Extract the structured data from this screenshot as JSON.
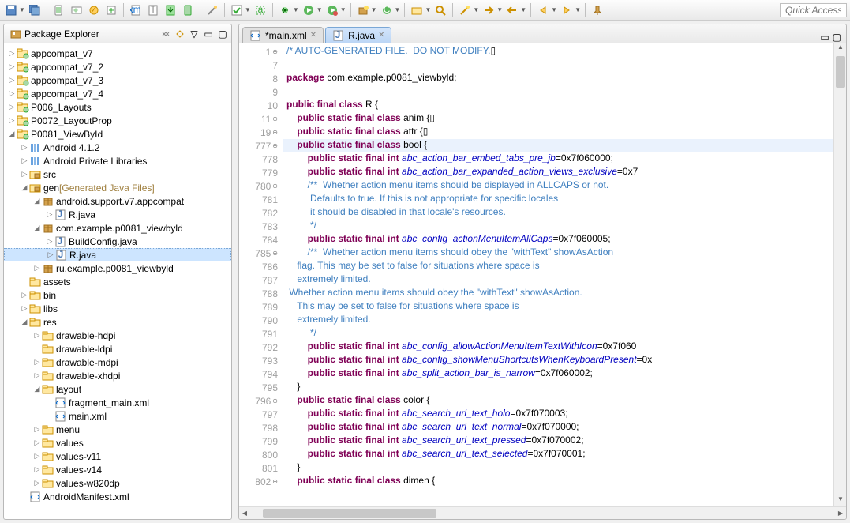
{
  "quick_access_placeholder": "Quick Access",
  "pkg_explorer_title": "Package Explorer",
  "tree": [
    {
      "d": 0,
      "t": "▷",
      "i": "prj",
      "l": "appcompat_v7"
    },
    {
      "d": 0,
      "t": "▷",
      "i": "prj",
      "l": "appcompat_v7_2"
    },
    {
      "d": 0,
      "t": "▷",
      "i": "prj",
      "l": "appcompat_v7_3"
    },
    {
      "d": 0,
      "t": "▷",
      "i": "prj",
      "l": "appcompat_v7_4"
    },
    {
      "d": 0,
      "t": "▷",
      "i": "prj",
      "l": "P006_Layouts"
    },
    {
      "d": 0,
      "t": "▷",
      "i": "prj",
      "l": "P0072_LayoutProp"
    },
    {
      "d": 0,
      "t": "◢",
      "i": "prj",
      "l": "P0081_ViewById"
    },
    {
      "d": 1,
      "t": "▷",
      "i": "lib",
      "l": "Android 4.1.2"
    },
    {
      "d": 1,
      "t": "▷",
      "i": "lib",
      "l": "Android Private Libraries"
    },
    {
      "d": 1,
      "t": "▷",
      "i": "pkgf",
      "l": "src"
    },
    {
      "d": 1,
      "t": "◢",
      "i": "pkgf",
      "l": "gen",
      "decor": " [Generated Java Files]"
    },
    {
      "d": 2,
      "t": "◢",
      "i": "pkg",
      "l": "android.support.v7.appcompat"
    },
    {
      "d": 3,
      "t": "▷",
      "i": "java",
      "l": "R.java"
    },
    {
      "d": 2,
      "t": "◢",
      "i": "pkg",
      "l": "com.example.p0081_viewbyld"
    },
    {
      "d": 3,
      "t": "▷",
      "i": "java",
      "l": "BuildConfig.java"
    },
    {
      "d": 3,
      "t": "▷",
      "i": "java",
      "l": "R.java",
      "sel": true
    },
    {
      "d": 2,
      "t": "▷",
      "i": "pkg",
      "l": "ru.example.p0081_viewbyld"
    },
    {
      "d": 1,
      "t": " ",
      "i": "fld",
      "l": "assets"
    },
    {
      "d": 1,
      "t": "▷",
      "i": "fld",
      "l": "bin"
    },
    {
      "d": 1,
      "t": "▷",
      "i": "fld",
      "l": "libs"
    },
    {
      "d": 1,
      "t": "◢",
      "i": "fld",
      "l": "res"
    },
    {
      "d": 2,
      "t": "▷",
      "i": "fld",
      "l": "drawable-hdpi"
    },
    {
      "d": 2,
      "t": " ",
      "i": "fld",
      "l": "drawable-ldpi"
    },
    {
      "d": 2,
      "t": "▷",
      "i": "fld",
      "l": "drawable-mdpi"
    },
    {
      "d": 2,
      "t": "▷",
      "i": "fld",
      "l": "drawable-xhdpi"
    },
    {
      "d": 2,
      "t": "◢",
      "i": "fld",
      "l": "layout"
    },
    {
      "d": 3,
      "t": " ",
      "i": "xml",
      "l": "fragment_main.xml"
    },
    {
      "d": 3,
      "t": " ",
      "i": "xml",
      "l": "main.xml"
    },
    {
      "d": 2,
      "t": "▷",
      "i": "fld",
      "l": "menu"
    },
    {
      "d": 2,
      "t": "▷",
      "i": "fld",
      "l": "values"
    },
    {
      "d": 2,
      "t": "▷",
      "i": "fld",
      "l": "values-v11"
    },
    {
      "d": 2,
      "t": "▷",
      "i": "fld",
      "l": "values-v14"
    },
    {
      "d": 2,
      "t": "▷",
      "i": "fld",
      "l": "values-w820dp"
    },
    {
      "d": 1,
      "t": " ",
      "i": "xml",
      "l": "AndroidManifest.xml"
    }
  ],
  "tabs": [
    {
      "label": "*main.xml",
      "icon": "xml",
      "active": false
    },
    {
      "label": "R.java",
      "icon": "java",
      "active": true
    }
  ],
  "code": {
    "lines": [
      {
        "n": "1",
        "fold": "⊕",
        "segs": [
          {
            "c": "com",
            "t": "/* AUTO-GENERATED FILE.  DO NOT MODIFY."
          },
          {
            "c": "pln",
            "t": "▯"
          }
        ]
      },
      {
        "n": "7",
        "segs": []
      },
      {
        "n": "8",
        "segs": [
          {
            "c": "kw",
            "t": "package"
          },
          {
            "c": "pln",
            "t": " com.example.p0081_viewbyld;"
          }
        ]
      },
      {
        "n": "9",
        "segs": []
      },
      {
        "n": "10",
        "segs": [
          {
            "c": "kw",
            "t": "public final class"
          },
          {
            "c": "pln",
            "t": " R {"
          }
        ]
      },
      {
        "n": "11",
        "fold": "⊕",
        "segs": [
          {
            "c": "pln",
            "t": "    "
          },
          {
            "c": "kw",
            "t": "public static final class"
          },
          {
            "c": "pln",
            "t": " anim {▯"
          }
        ]
      },
      {
        "n": "19",
        "fold": "⊕",
        "segs": [
          {
            "c": "pln",
            "t": "    "
          },
          {
            "c": "kw",
            "t": "public static final class"
          },
          {
            "c": "pln",
            "t": " attr {▯"
          }
        ]
      },
      {
        "n": "777",
        "fold": "⊖",
        "hl": true,
        "segs": [
          {
            "c": "pln",
            "t": "    "
          },
          {
            "c": "kw",
            "t": "public static final class"
          },
          {
            "c": "pln",
            "t": " bool {"
          }
        ]
      },
      {
        "n": "778",
        "segs": [
          {
            "c": "pln",
            "t": "        "
          },
          {
            "c": "kw",
            "t": "public static final int"
          },
          {
            "c": "pln",
            "t": " "
          },
          {
            "c": "fld",
            "t": "abc_action_bar_embed_tabs_pre_jb"
          },
          {
            "c": "pln",
            "t": "=0x7f060000;"
          }
        ]
      },
      {
        "n": "779",
        "segs": [
          {
            "c": "pln",
            "t": "        "
          },
          {
            "c": "kw",
            "t": "public static final int"
          },
          {
            "c": "pln",
            "t": " "
          },
          {
            "c": "fld",
            "t": "abc_action_bar_expanded_action_views_exclusive"
          },
          {
            "c": "pln",
            "t": "=0x7"
          }
        ]
      },
      {
        "n": "780",
        "fold": "⊖",
        "segs": [
          {
            "c": "pln",
            "t": "        "
          },
          {
            "c": "com",
            "t": "/**  Whether action menu items should be displayed in ALLCAPS or not."
          }
        ]
      },
      {
        "n": "781",
        "segs": [
          {
            "c": "com",
            "t": "         Defaults to true. If this is not appropriate for specific locales"
          }
        ]
      },
      {
        "n": "782",
        "segs": [
          {
            "c": "com",
            "t": "         it should be disabled in that locale's resources."
          }
        ]
      },
      {
        "n": "783",
        "segs": [
          {
            "c": "com",
            "t": "         */"
          }
        ]
      },
      {
        "n": "784",
        "segs": [
          {
            "c": "pln",
            "t": "        "
          },
          {
            "c": "kw",
            "t": "public static final int"
          },
          {
            "c": "pln",
            "t": " "
          },
          {
            "c": "fld",
            "t": "abc_config_actionMenuItemAllCaps"
          },
          {
            "c": "pln",
            "t": "=0x7f060005;"
          }
        ]
      },
      {
        "n": "785",
        "fold": "⊖",
        "segs": [
          {
            "c": "pln",
            "t": "        "
          },
          {
            "c": "com",
            "t": "/**  Whether action menu items should obey the \"withText\" showAsAction"
          }
        ]
      },
      {
        "n": "786",
        "segs": [
          {
            "c": "com",
            "t": "    flag. This may be set to false for situations where space is"
          }
        ]
      },
      {
        "n": "787",
        "segs": [
          {
            "c": "com",
            "t": "    extremely limited."
          }
        ]
      },
      {
        "n": "788",
        "segs": [
          {
            "c": "com",
            "t": " Whether action menu items should obey the \"withText\" showAsAction."
          }
        ]
      },
      {
        "n": "789",
        "segs": [
          {
            "c": "com",
            "t": "    This may be set to false for situations where space is"
          }
        ]
      },
      {
        "n": "790",
        "segs": [
          {
            "c": "com",
            "t": "    extremely limited."
          }
        ]
      },
      {
        "n": "791",
        "segs": [
          {
            "c": "com",
            "t": "         */"
          }
        ]
      },
      {
        "n": "792",
        "segs": [
          {
            "c": "pln",
            "t": "        "
          },
          {
            "c": "kw",
            "t": "public static final int"
          },
          {
            "c": "pln",
            "t": " "
          },
          {
            "c": "fld",
            "t": "abc_config_allowActionMenuItemTextWithIcon"
          },
          {
            "c": "pln",
            "t": "=0x7f060"
          }
        ]
      },
      {
        "n": "793",
        "segs": [
          {
            "c": "pln",
            "t": "        "
          },
          {
            "c": "kw",
            "t": "public static final int"
          },
          {
            "c": "pln",
            "t": " "
          },
          {
            "c": "fld",
            "t": "abc_config_showMenuShortcutsWhenKeyboardPresent"
          },
          {
            "c": "pln",
            "t": "=0x"
          }
        ]
      },
      {
        "n": "794",
        "segs": [
          {
            "c": "pln",
            "t": "        "
          },
          {
            "c": "kw",
            "t": "public static final int"
          },
          {
            "c": "pln",
            "t": " "
          },
          {
            "c": "fld",
            "t": "abc_split_action_bar_is_narrow"
          },
          {
            "c": "pln",
            "t": "=0x7f060002;"
          }
        ]
      },
      {
        "n": "795",
        "segs": [
          {
            "c": "pln",
            "t": "    }"
          }
        ]
      },
      {
        "n": "796",
        "fold": "⊖",
        "segs": [
          {
            "c": "pln",
            "t": "    "
          },
          {
            "c": "kw",
            "t": "public static final class"
          },
          {
            "c": "pln",
            "t": " color {"
          }
        ]
      },
      {
        "n": "797",
        "segs": [
          {
            "c": "pln",
            "t": "        "
          },
          {
            "c": "kw",
            "t": "public static final int"
          },
          {
            "c": "pln",
            "t": " "
          },
          {
            "c": "fld",
            "t": "abc_search_url_text_holo"
          },
          {
            "c": "pln",
            "t": "=0x7f070003;"
          }
        ]
      },
      {
        "n": "798",
        "segs": [
          {
            "c": "pln",
            "t": "        "
          },
          {
            "c": "kw",
            "t": "public static final int"
          },
          {
            "c": "pln",
            "t": " "
          },
          {
            "c": "fld",
            "t": "abc_search_url_text_normal"
          },
          {
            "c": "pln",
            "t": "=0x7f070000;"
          }
        ]
      },
      {
        "n": "799",
        "segs": [
          {
            "c": "pln",
            "t": "        "
          },
          {
            "c": "kw",
            "t": "public static final int"
          },
          {
            "c": "pln",
            "t": " "
          },
          {
            "c": "fld",
            "t": "abc_search_url_text_pressed"
          },
          {
            "c": "pln",
            "t": "=0x7f070002;"
          }
        ]
      },
      {
        "n": "800",
        "segs": [
          {
            "c": "pln",
            "t": "        "
          },
          {
            "c": "kw",
            "t": "public static final int"
          },
          {
            "c": "pln",
            "t": " "
          },
          {
            "c": "fld",
            "t": "abc_search_url_text_selected"
          },
          {
            "c": "pln",
            "t": "=0x7f070001;"
          }
        ]
      },
      {
        "n": "801",
        "segs": [
          {
            "c": "pln",
            "t": "    }"
          }
        ]
      },
      {
        "n": "802",
        "fold": "⊖",
        "segs": [
          {
            "c": "pln",
            "t": "    "
          },
          {
            "c": "kw",
            "t": "public static final class"
          },
          {
            "c": "pln",
            "t": " dimen {"
          }
        ]
      }
    ]
  }
}
